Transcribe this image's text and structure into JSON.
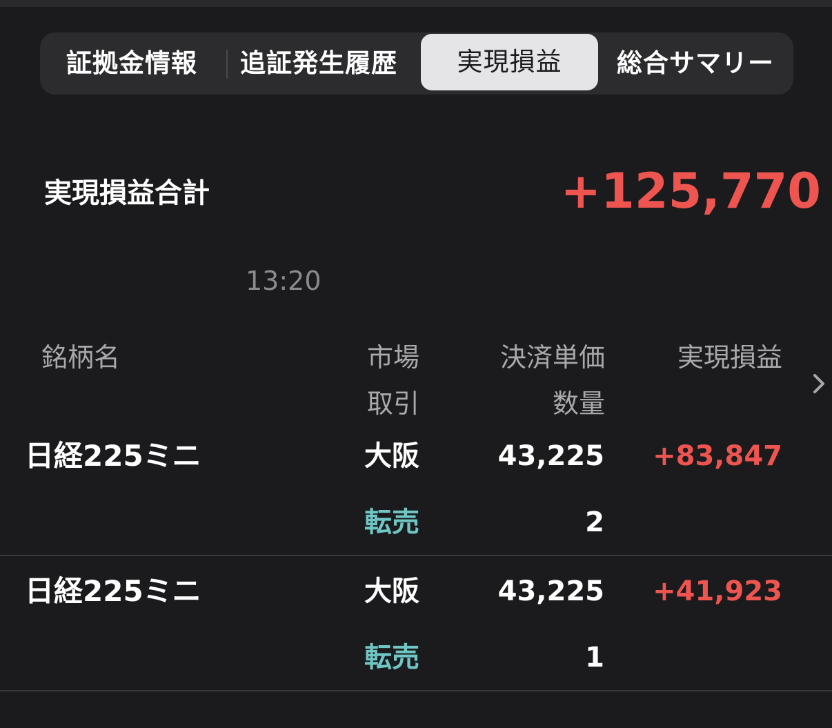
{
  "tabs": [
    {
      "label": "証拠金情報"
    },
    {
      "label": "追証発生履歴"
    },
    {
      "label": "実現損益"
    },
    {
      "label": "総合サマリー"
    }
  ],
  "summary": {
    "total_label": "実現損益合計",
    "total_value": "+125,770",
    "time": "13:20"
  },
  "table": {
    "headers": {
      "name": "銘柄名",
      "market": "市場",
      "type": "取引",
      "price": "決済単価",
      "qty": "数量",
      "pnl": "実現損益"
    },
    "rows": [
      {
        "name": "日経225ミニ",
        "market": "大阪",
        "type": "転売",
        "price": "43,225",
        "qty": "2",
        "pnl": "+83,847"
      },
      {
        "name": "日経225ミニ",
        "market": "大阪",
        "type": "転売",
        "price": "43,225",
        "qty": "1",
        "pnl": "+41,923"
      }
    ]
  },
  "colors": {
    "background": "#1b1b1d",
    "profit": "#ee5551",
    "trade_type": "#6fc6c4",
    "active_tab": "#e5e5e7"
  },
  "icons": {
    "scroll_right": "chevron-right-icon"
  }
}
